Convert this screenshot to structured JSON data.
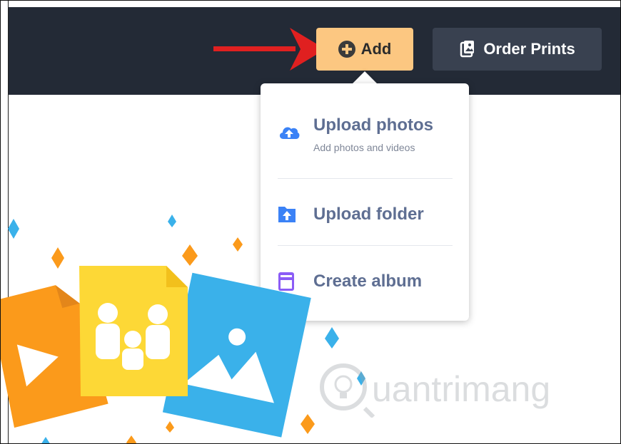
{
  "toolbar": {
    "add_label": "Add",
    "order_prints_label": "Order Prints"
  },
  "menu": {
    "items": [
      {
        "title": "Upload photos",
        "subtitle": "Add photos and videos"
      },
      {
        "title": "Upload folder"
      },
      {
        "title": "Create album"
      }
    ]
  },
  "watermark": {
    "text": "uantrimang"
  },
  "colors": {
    "topbar": "#232a36",
    "add_button": "#fcc781",
    "order_button": "#394150",
    "menu_text": "#5e6e92",
    "upload_icon": "#3b82f6",
    "album_icon": "#8b5cf6",
    "arrow": "#e02020"
  }
}
